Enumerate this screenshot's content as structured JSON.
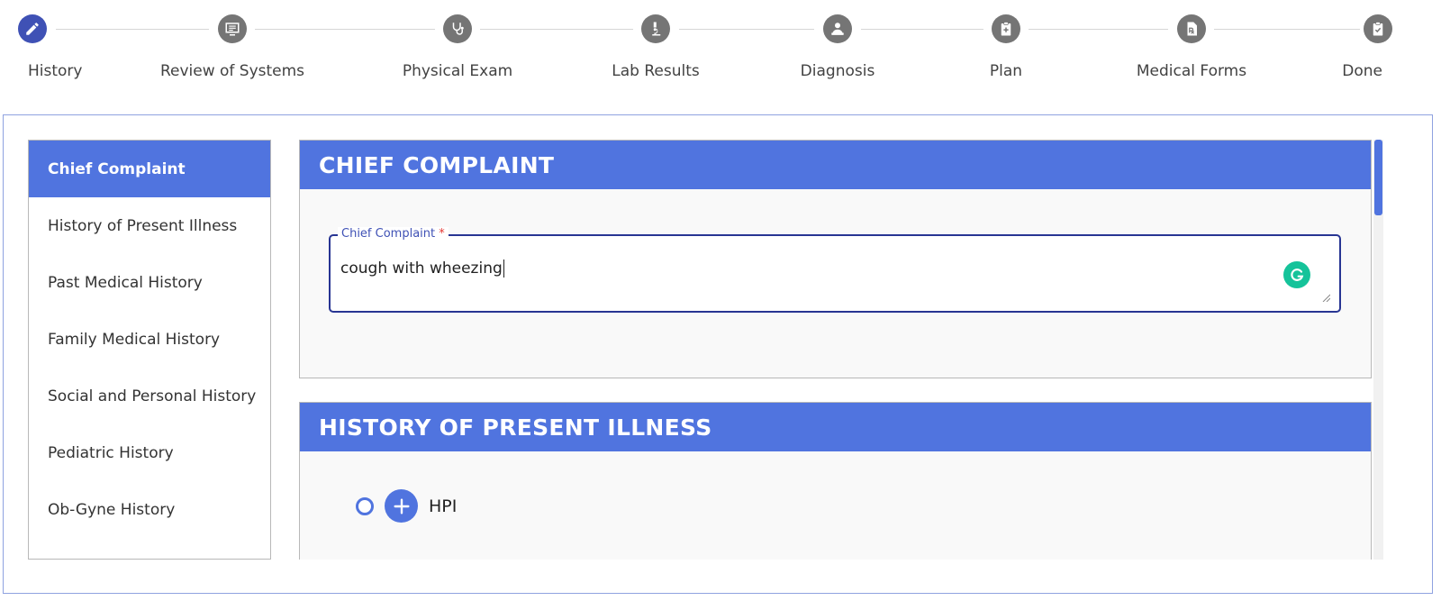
{
  "stepper": {
    "steps": [
      {
        "label": "History",
        "icon": "pencil-icon",
        "active": true
      },
      {
        "label": "Review of Systems",
        "icon": "monitor-icon",
        "active": false
      },
      {
        "label": "Physical Exam",
        "icon": "stethoscope-icon",
        "active": false
      },
      {
        "label": "Lab Results",
        "icon": "microscope-icon",
        "active": false
      },
      {
        "label": "Diagnosis",
        "icon": "doctor-icon",
        "active": false
      },
      {
        "label": "Plan",
        "icon": "clipboard-plus-icon",
        "active": false
      },
      {
        "label": "Medical Forms",
        "icon": "prescription-icon",
        "active": false
      },
      {
        "label": "Done",
        "icon": "clipboard-check-icon",
        "active": false
      }
    ]
  },
  "sidebar": {
    "items": [
      {
        "label": "Chief Complaint",
        "active": true
      },
      {
        "label": "History of Present Illness"
      },
      {
        "label": "Past Medical History"
      },
      {
        "label": "Family Medical History"
      },
      {
        "label": "Social and Personal History"
      },
      {
        "label": "Pediatric History"
      },
      {
        "label": "Ob-Gyne History"
      }
    ]
  },
  "chief_complaint": {
    "title": "CHIEF COMPLAINT",
    "field_label": "Chief Complaint",
    "required_mark": "*",
    "value": "cough with wheezing"
  },
  "hpi": {
    "title": "HISTORY OF PRESENT ILLNESS",
    "item_label": "HPI"
  },
  "colors": {
    "primary": "#5074df",
    "active_step": "#3f51b5",
    "inactive_step": "#757575",
    "field_border": "#283593",
    "grammarly": "#15c39a"
  }
}
